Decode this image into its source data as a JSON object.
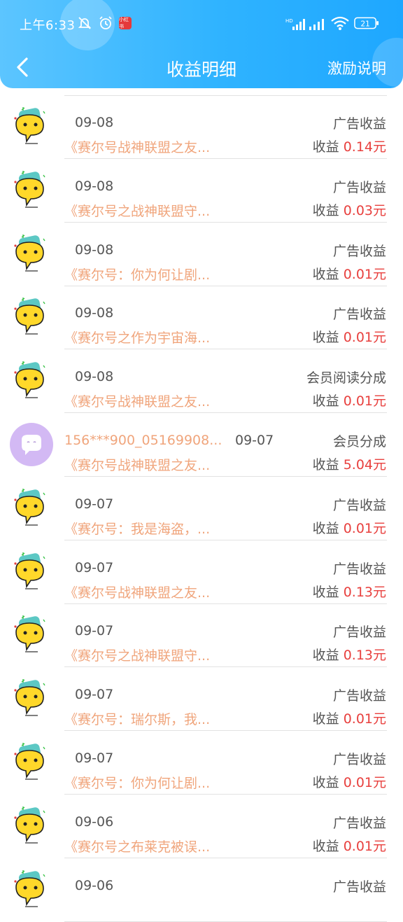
{
  "status_bar": {
    "time": "上午6:33",
    "icons": [
      "mute-icon",
      "alarm-icon",
      "app-badge",
      "signal-hd-icon",
      "signal-icon",
      "wifi-icon",
      "battery-icon"
    ],
    "battery": "21"
  },
  "header": {
    "title": "收益明细",
    "right_link": "激励说明",
    "gradient": [
      "#5cc5ff",
      "#1ea7ff"
    ]
  },
  "earn_prefix": "收益",
  "colors": {
    "book": "#f0a57c",
    "amount": "#e8403e",
    "text": "#555555"
  },
  "rows": [
    {
      "avatar": "face",
      "date": "09-08",
      "type": "广告收益",
      "book": "《赛尔号战神联盟之友...",
      "amount": "0.14元"
    },
    {
      "avatar": "face",
      "date": "09-08",
      "type": "广告收益",
      "book": "《赛尔号之战神联盟守...",
      "amount": "0.03元"
    },
    {
      "avatar": "face",
      "date": "09-08",
      "type": "广告收益",
      "book": "《赛尔号：你为何让剧...",
      "amount": "0.01元"
    },
    {
      "avatar": "face",
      "date": "09-08",
      "type": "广告收益",
      "book": "《赛尔号之作为宇宙海...",
      "amount": "0.01元"
    },
    {
      "avatar": "face",
      "date": "09-08",
      "type": "会员阅读分成",
      "book": "《赛尔号战神联盟之友...",
      "amount": "0.01元"
    },
    {
      "avatar": "user",
      "user": "156***900_05169908...",
      "date": "09-07",
      "type": "会员分成",
      "book": "《赛尔号战神联盟之友...",
      "amount": "5.04元"
    },
    {
      "avatar": "face",
      "date": "09-07",
      "type": "广告收益",
      "book": "《赛尔号：我是海盗，...",
      "amount": "0.01元"
    },
    {
      "avatar": "face",
      "date": "09-07",
      "type": "广告收益",
      "book": "《赛尔号战神联盟之友...",
      "amount": "0.13元"
    },
    {
      "avatar": "face",
      "date": "09-07",
      "type": "广告收益",
      "book": "《赛尔号之战神联盟守...",
      "amount": "0.13元"
    },
    {
      "avatar": "face",
      "date": "09-07",
      "type": "广告收益",
      "book": "《赛尔号：瑞尔斯，我...",
      "amount": "0.01元"
    },
    {
      "avatar": "face",
      "date": "09-07",
      "type": "广告收益",
      "book": "《赛尔号：你为何让剧...",
      "amount": "0.01元"
    },
    {
      "avatar": "face",
      "date": "09-06",
      "type": "广告收益",
      "book": "《赛尔号之布莱克被误...",
      "amount": "0.01元"
    },
    {
      "avatar": "face",
      "date": "09-06",
      "type": "广告收益",
      "book": "",
      "amount": ""
    }
  ]
}
